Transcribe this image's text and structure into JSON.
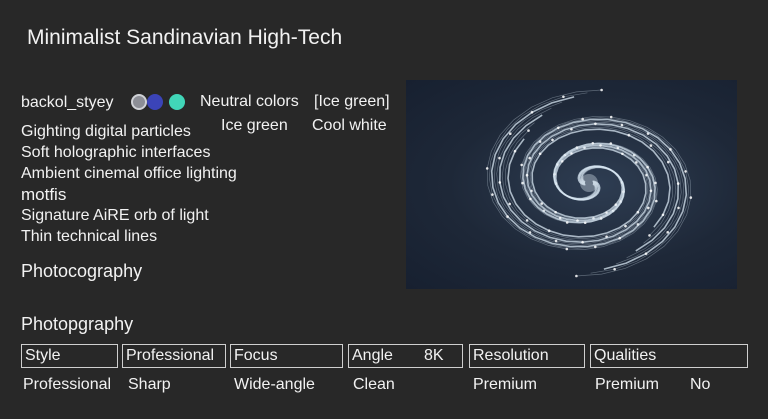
{
  "title": "Minimalist Sandinavian High-Tech",
  "style_row": {
    "label": "backol_styey",
    "neutral": "Neutral colors",
    "bracket": "[Ice green]",
    "ice_green": "Ice green",
    "cool_white": "Cool white"
  },
  "swatches": [
    "#8c8e96",
    "#3b44b8",
    "#41d6b8"
  ],
  "lines": [
    "Gighting digital particles",
    "Soft holographic interfaces",
    "Ambient cinemal office lighting"
  ],
  "motifs_heading": "motfis",
  "motifs": [
    "Signature AiRE orb of light",
    "Thin technical lines"
  ],
  "heading1": "Photocography",
  "heading2": "Photopgraphy",
  "table": {
    "headers": [
      "Style",
      "Professional",
      "Focus",
      "Angle",
      "8K",
      "Resolution",
      "Qualities"
    ],
    "values": [
      "Professional",
      "Sharp",
      "Wide-angle",
      "Clean",
      "Premium",
      "Premium",
      "No"
    ]
  },
  "colors": {
    "background": "#282828",
    "text": "#f2f2f2",
    "image_bg": "#1e2838",
    "spiral": "#d7e6f2"
  },
  "image_description_icon": "galaxy-spiral-icon"
}
